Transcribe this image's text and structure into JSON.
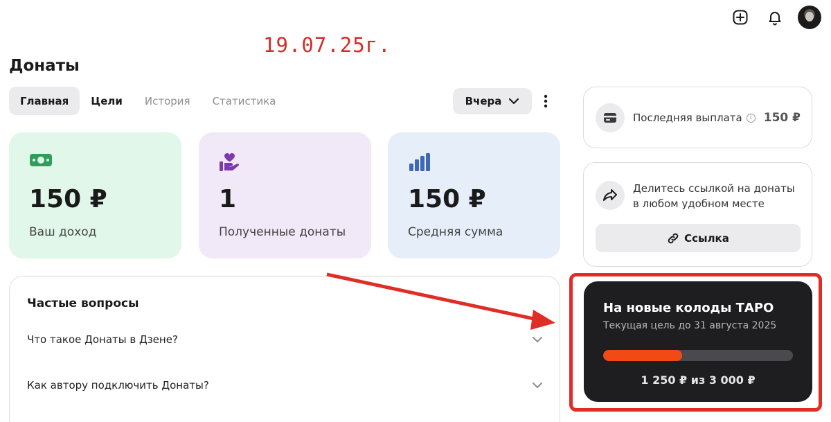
{
  "date_stamp": "19.07.25г.",
  "page_title": "Донаты",
  "tabs": [
    {
      "label": "Главная"
    },
    {
      "label": "Цели"
    },
    {
      "label": "История"
    },
    {
      "label": "Статистика"
    }
  ],
  "period_select": {
    "value": "Вчера"
  },
  "stats": [
    {
      "value": "150 ₽",
      "label": "Ваш доход",
      "icon": "money-icon"
    },
    {
      "value": "1",
      "label": "Полученные донаты",
      "icon": "heart-hand-icon"
    },
    {
      "value": "150 ₽",
      "label": "Средняя сумма",
      "icon": "bar-chart-icon"
    }
  ],
  "faq": {
    "title": "Частые вопросы",
    "items": [
      {
        "question": "Что такое Донаты в Дзене?"
      },
      {
        "question": "Как автору подключить Донаты?"
      }
    ]
  },
  "payout": {
    "label": "Последняя выплата",
    "amount": "150 ₽"
  },
  "share": {
    "text": "Делитесь ссылкой на донаты в любом удобном месте",
    "button_label": "Ссылка"
  },
  "goal": {
    "title": "На новые колоды ТАРО",
    "subtitle": "Текущая цель до 31 августа 2025",
    "progress_text": "1 250 ₽ из 3 000 ₽",
    "collected": 1250,
    "target": 3000
  },
  "colors": {
    "accent": "#f14a14",
    "annotation": "#d42c26"
  }
}
